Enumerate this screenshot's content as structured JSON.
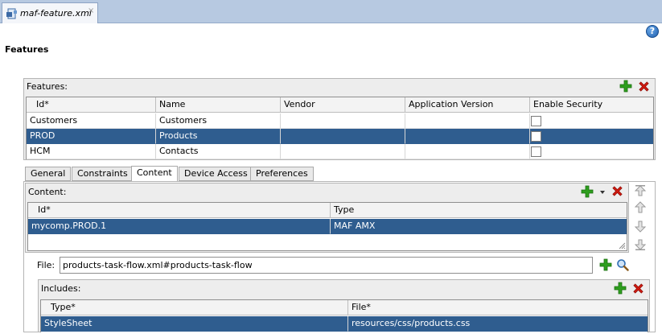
{
  "editor_tab": {
    "title": "maf-feature.xml",
    "close": "×",
    "icon": "xml-file-icon"
  },
  "help": {
    "icon": "help-icon",
    "glyph": "?"
  },
  "page_title": "Features",
  "features_panel": {
    "label": "Features:",
    "columns": [
      "Id*",
      "Name",
      "Vendor",
      "Application Version",
      "Enable Security"
    ],
    "rows": [
      {
        "id": "Customers",
        "name": "Customers",
        "vendor": "",
        "app_version": "",
        "enable_security": false
      },
      {
        "id": "PROD",
        "name": "Products",
        "vendor": "",
        "app_version": "",
        "enable_security": false,
        "selected": true
      },
      {
        "id": "HCM",
        "name": "Contacts",
        "vendor": "",
        "app_version": "",
        "enable_security": false
      }
    ]
  },
  "sub_tabs": [
    "General",
    "Constraints",
    "Content",
    "Device Access",
    "Preferences"
  ],
  "active_sub_tab": "Content",
  "content_panel": {
    "label": "Content:",
    "columns": [
      "Id*",
      "Type"
    ],
    "rows": [
      {
        "id": "mycomp.PROD.1",
        "type": "MAF AMX",
        "selected": true
      }
    ]
  },
  "file_field": {
    "label": "File:",
    "value": "products-task-flow.xml#products-task-flow"
  },
  "includes_panel": {
    "label": "Includes:",
    "columns": [
      "Type*",
      "File*"
    ],
    "rows": [
      {
        "type": "StyleSheet",
        "file": "resources/css/products.css",
        "selected": true
      }
    ]
  },
  "colors": {
    "selection": "#2f5d8f",
    "tabstrip": "#b7c9e1",
    "add_green": "#2e9e1e",
    "delete_red": "#d01a10"
  }
}
